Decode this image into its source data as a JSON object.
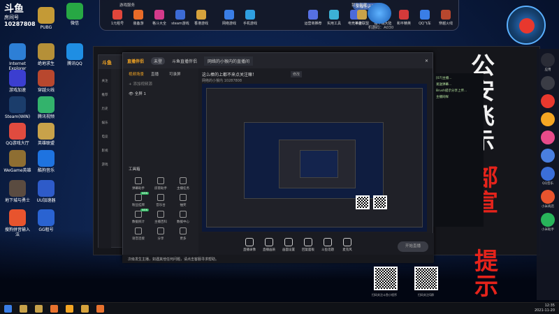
{
  "desktop": {
    "brand": {
      "line1": "斗鱼",
      "line2": "房间号",
      "room_no": "10287808"
    },
    "icons": [
      {
        "label": "PUBG",
        "sub": "UBG/HTX",
        "color": "#c49a36"
      },
      {
        "label": "微信",
        "color": "#27a844"
      },
      {
        "label": "Internet Explorer",
        "color": "#2d7fd6"
      },
      {
        "label": "绝地求生",
        "color": "#b59038"
      },
      {
        "label": "腾讯QQ",
        "color": "#1f8ee3"
      },
      {
        "label": "游戏加速",
        "color": "#3b3ed0"
      },
      {
        "label": "穿越火线",
        "color": "#b8472e"
      },
      {
        "label": "Steam(WIN)",
        "color": "#1b3d6b"
      },
      {
        "label": "腾讯视频",
        "color": "#33b36c"
      },
      {
        "label": "QQ游戏大厅",
        "color": "#e04b3f"
      },
      {
        "label": "英雄联盟",
        "color": "#c8a24a"
      },
      {
        "label": "WeGame英雄",
        "color": "#8e6e32"
      },
      {
        "label": "酷狗音乐",
        "color": "#1e73e0"
      },
      {
        "label": "地下城与勇士",
        "color": "#5a4b40"
      },
      {
        "label": "UU加速器",
        "color": "#2e5bc9"
      },
      {
        "label": "搜狗拼音输入法",
        "color": "#e8542e"
      },
      {
        "label": "GG租号",
        "color": "#2a63d1"
      }
    ]
  },
  "topbar": {
    "section_games": "游戏服务",
    "section_mine": "我的都藏",
    "items_left": [
      "1元租号",
      "装备游",
      "格斗大全",
      "steam游戏",
      "香港游戏"
    ],
    "items_mid": [
      "网络游戏",
      "手机游戏",
      "运营商推荐",
      "实用工具",
      "电竞平台"
    ],
    "items_right": [
      "英雄联盟",
      "撸干城大陆",
      "和平精英",
      "QQ飞车",
      "穿越火线"
    ],
    "bubble": "来福佳话游戏",
    "mascot_label": "畅乐游",
    "machine": "机器码：A030"
  },
  "orb": {
    "label": "功能"
  },
  "rightbar": {
    "items": [
      "应用",
      "",
      "",
      "",
      "",
      "",
      "QQ音乐",
      "小米商店",
      "小米助手"
    ]
  },
  "game_window": {
    "brand": "斗鱼",
    "sidebar": [
      "关注",
      "推荐",
      "历史",
      "娱乐",
      "电竞",
      "影视",
      "游戏"
    ]
  },
  "obs_panel": {
    "title": "直播伴侣",
    "badge": "未登",
    "tabs": [
      "视频场景",
      "直播",
      "可录屏"
    ],
    "scene": "全屏 1",
    "add_source": "+ 添加视频源",
    "tools_header": "工具箱",
    "tools": [
      {
        "label": "弹幕助手",
        "new": false
      },
      {
        "label": "房管助手",
        "new": false
      },
      {
        "label": "主播任务",
        "new": false
      },
      {
        "label": "粉丝挂牌",
        "new": true
      },
      {
        "label": "音乐台",
        "new": false
      },
      {
        "label": "抽奖",
        "new": false
      },
      {
        "label": "数据统计",
        "new": true
      },
      {
        "label": "主播百科",
        "new": false
      },
      {
        "label": "数据中心",
        "new": false
      },
      {
        "label": "语音连接",
        "new": false
      },
      {
        "label": "分享",
        "new": false
      },
      {
        "label": "更多",
        "new": false
      }
    ]
  },
  "main_window": {
    "tab_title": "斗鱼直播伴侣",
    "tab2": "网络的小猴内的直播间",
    "headline": "这么棒的上都不来点关注嘛！",
    "edit": "修改",
    "game_category": "英雄联盟 - 大乱斗",
    "subtitle": "网络的小猴内  10287808",
    "bottom_buttons": [
      "直播录像",
      "直播画质",
      "画面设置",
      "回复面板",
      "斗鱼话题",
      "麦克风"
    ],
    "go_live": "开始直播",
    "status": "次级发生主播，如遇其他任何问题，请点击客服寻求帮助。"
  },
  "qr": [
    {
      "label": "扫码关注斗鱼小程序"
    },
    {
      "label": "扫码关注Q群"
    }
  ],
  "overlay_text": {
    "col1": "公安飞示",
    "col2": "部宣",
    "col3": "提示"
  },
  "chat_lines": [
    "[07]主播...",
    "发送弹幕...",
    "Brush提示分享上传...",
    "主播同样"
  ],
  "clock": {
    "time": "12:35",
    "date": "2021-11-20"
  }
}
